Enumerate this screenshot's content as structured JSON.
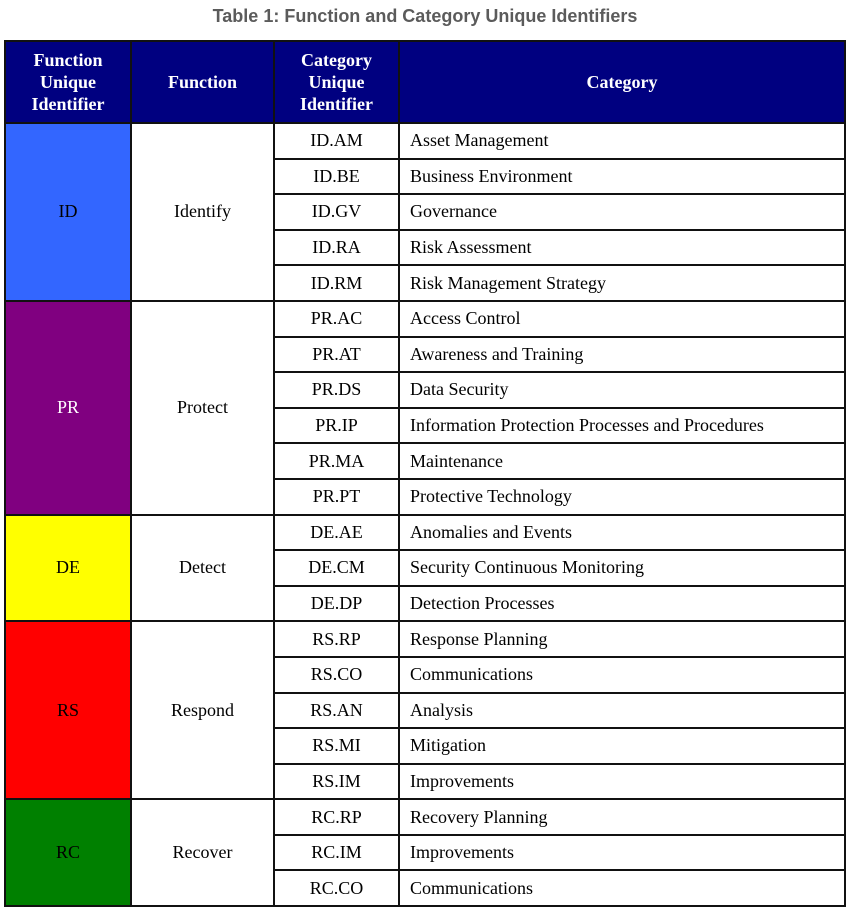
{
  "title": "Table 1: Function and Category Unique Identifiers",
  "headers": {
    "fid": [
      "Function",
      "Unique",
      "Identifier"
    ],
    "function": "Function",
    "cid": [
      "Category",
      "Unique",
      "Identifier"
    ],
    "category": "Category"
  },
  "functions": [
    {
      "id": "ID",
      "name": "Identify",
      "color": "#3366ff",
      "text_color": "#000000",
      "categories": [
        {
          "id": "ID.AM",
          "name": "Asset Management"
        },
        {
          "id": "ID.BE",
          "name": "Business Environment"
        },
        {
          "id": "ID.GV",
          "name": "Governance"
        },
        {
          "id": "ID.RA",
          "name": "Risk Assessment"
        },
        {
          "id": "ID.RM",
          "name": "Risk Management Strategy"
        }
      ]
    },
    {
      "id": "PR",
      "name": "Protect",
      "color": "#800080",
      "text_color": "#ffffff",
      "categories": [
        {
          "id": "PR.AC",
          "name": "Access Control"
        },
        {
          "id": "PR.AT",
          "name": "Awareness and Training"
        },
        {
          "id": "PR.DS",
          "name": "Data Security"
        },
        {
          "id": "PR.IP",
          "name": "Information Protection Processes and Procedures"
        },
        {
          "id": "PR.MA",
          "name": "Maintenance"
        },
        {
          "id": "PR.PT",
          "name": "Protective Technology"
        }
      ]
    },
    {
      "id": "DE",
      "name": "Detect",
      "color": "#ffff00",
      "text_color": "#000000",
      "categories": [
        {
          "id": "DE.AE",
          "name": "Anomalies and Events"
        },
        {
          "id": "DE.CM",
          "name": "Security Continuous Monitoring"
        },
        {
          "id": "DE.DP",
          "name": "Detection Processes"
        }
      ]
    },
    {
      "id": "RS",
      "name": "Respond",
      "color": "#ff0000",
      "text_color": "#000000",
      "categories": [
        {
          "id": "RS.RP",
          "name": "Response Planning"
        },
        {
          "id": "RS.CO",
          "name": "Communications"
        },
        {
          "id": "RS.AN",
          "name": "Analysis"
        },
        {
          "id": "RS.MI",
          "name": "Mitigation"
        },
        {
          "id": "RS.IM",
          "name": "Improvements"
        }
      ]
    },
    {
      "id": "RC",
      "name": "Recover",
      "color": "#008000",
      "text_color": "#000000",
      "categories": [
        {
          "id": "RC.RP",
          "name": "Recovery Planning"
        },
        {
          "id": "RC.IM",
          "name": "Improvements"
        },
        {
          "id": "RC.CO",
          "name": "Communications"
        }
      ]
    }
  ]
}
